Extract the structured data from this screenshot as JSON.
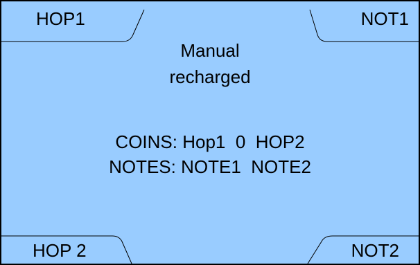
{
  "buttons": {
    "hop1": "HOP1",
    "not1": "NOT1",
    "hop2": "HOP 2",
    "not2": "NOT2"
  },
  "status": {
    "line1": "Manual",
    "line2": "recharged"
  },
  "info": {
    "coins_label": "COINS:",
    "coins_hop1": "Hop1",
    "coins_value": "0",
    "coins_hop2": "HOP2",
    "notes_label": "NOTES:",
    "notes_note1": "NOTE1",
    "notes_note2": "NOTE2"
  },
  "colors": {
    "background": "#99ccff",
    "text": "#000000",
    "lines": "#000000"
  }
}
